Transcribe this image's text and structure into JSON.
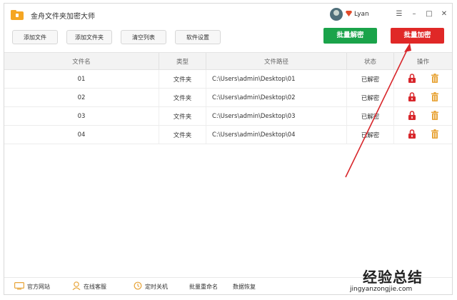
{
  "app": {
    "title": "金舟文件夹加密大师"
  },
  "user": {
    "name": "Lyan"
  },
  "window_controls": {
    "menu": "☰",
    "minimize": "–",
    "maximize": "□",
    "close": "✕"
  },
  "toolbar": {
    "add_file": "添加文件",
    "add_folder": "添加文件夹",
    "clear_list": "清空列表",
    "settings": "软件设置",
    "batch_decrypt": "批量解密",
    "batch_encrypt": "批量加密"
  },
  "table": {
    "headers": [
      "文件名",
      "类型",
      "文件路径",
      "状态",
      "操作"
    ],
    "rows": [
      {
        "name": "01",
        "type": "文件夹",
        "path": "C:\\Users\\admin\\Desktop\\01",
        "status": "已解密"
      },
      {
        "name": "02",
        "type": "文件夹",
        "path": "C:\\Users\\admin\\Desktop\\02",
        "status": "已解密"
      },
      {
        "name": "03",
        "type": "文件夹",
        "path": "C:\\Users\\admin\\Desktop\\03",
        "status": "已解密"
      },
      {
        "name": "04",
        "type": "文件夹",
        "path": "C:\\Users\\admin\\Desktop\\04",
        "status": "已解密"
      }
    ]
  },
  "footer": {
    "website": "官方网站",
    "support": "在线客服",
    "shutdown": "定时关机",
    "rename": "批量重命名",
    "recovery": "数据恢复"
  },
  "watermark": {
    "cn": "经验总结",
    "url": "jingyanzongjie.com"
  },
  "colors": {
    "green": "#1aa34a",
    "red": "#e02827",
    "lock": "#d8262b",
    "trash": "#e8a53a"
  },
  "icons": {
    "lock": "lock-icon",
    "trash": "trash-icon"
  }
}
